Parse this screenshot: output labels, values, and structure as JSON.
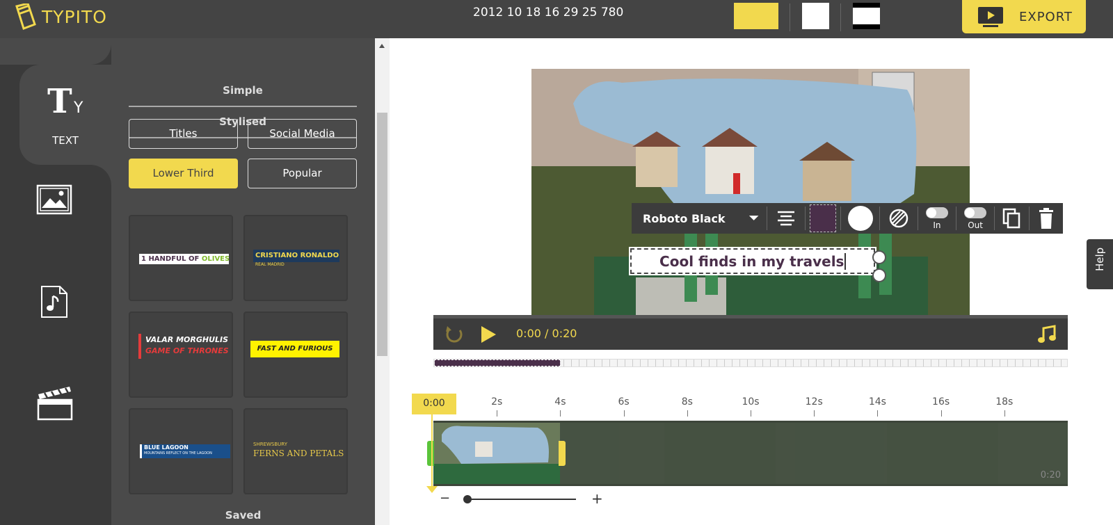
{
  "app": {
    "name": "TYPITO",
    "project_title": "2012 10 18 16 29 25 780"
  },
  "header": {
    "export_label": "EXPORT",
    "aspect_ratios": [
      {
        "name": "landscape",
        "color": "#f2d94e",
        "selected": true
      },
      {
        "name": "square",
        "color": "#ffffff",
        "selected": false
      },
      {
        "name": "widescreen",
        "color": "#ffffff",
        "selected": false
      }
    ]
  },
  "rail": {
    "items": [
      {
        "name": "text",
        "label": "TEXT",
        "icon": "text-icon",
        "active": true
      },
      {
        "name": "image",
        "label": "",
        "icon": "image-icon",
        "active": false
      },
      {
        "name": "audio",
        "label": "",
        "icon": "music-file-icon",
        "active": false
      },
      {
        "name": "video",
        "label": "",
        "icon": "clapperboard-icon",
        "active": false
      }
    ]
  },
  "panel": {
    "tabs": [
      "Simple",
      "Stylised"
    ],
    "categories": [
      {
        "label": "Titles",
        "active": false
      },
      {
        "label": "Social Media",
        "active": false
      },
      {
        "label": "Lower Third",
        "active": true
      },
      {
        "label": "Popular",
        "active": false
      }
    ],
    "templates": [
      {
        "line1a": "1 HANDFUL OF ",
        "line1b": "OLIVES",
        "line2": ""
      },
      {
        "line1a": "CRISTIANO RONALDO",
        "line1b": "",
        "line2": "REAL MADRID"
      },
      {
        "line1a": "VALAR MORGHULIS",
        "line1b": "",
        "line2": "GAME OF THRONES"
      },
      {
        "line1a": "FAST AND FURIOUS",
        "line1b": "",
        "line2": ""
      },
      {
        "line1a": "BLUE LAGOON",
        "line1b": "",
        "line2": "MOUNTAINS REFLECT ON THE LAGOON"
      },
      {
        "line1a": "SHREWSBURY",
        "line1b": "",
        "line2": "FERNS AND PETALS"
      }
    ],
    "saved_label": "Saved"
  },
  "editor": {
    "font_name": "Roboto Black",
    "text_color": "#4a2f4a",
    "anim_in_label": "In",
    "anim_out_label": "Out",
    "caption_text": "Cool finds in my travels"
  },
  "player": {
    "current_time": "0:00",
    "separator": "/",
    "duration": "0:20",
    "progress": 0.2
  },
  "timeline": {
    "playhead_label": "0:00",
    "ticks": [
      "2s",
      "4s",
      "6s",
      "8s",
      "10s",
      "12s",
      "14s",
      "16s",
      "18s"
    ],
    "end_label": "0:20",
    "zoom_minus": "−",
    "zoom_plus": "+"
  },
  "help": {
    "label": "Help"
  }
}
